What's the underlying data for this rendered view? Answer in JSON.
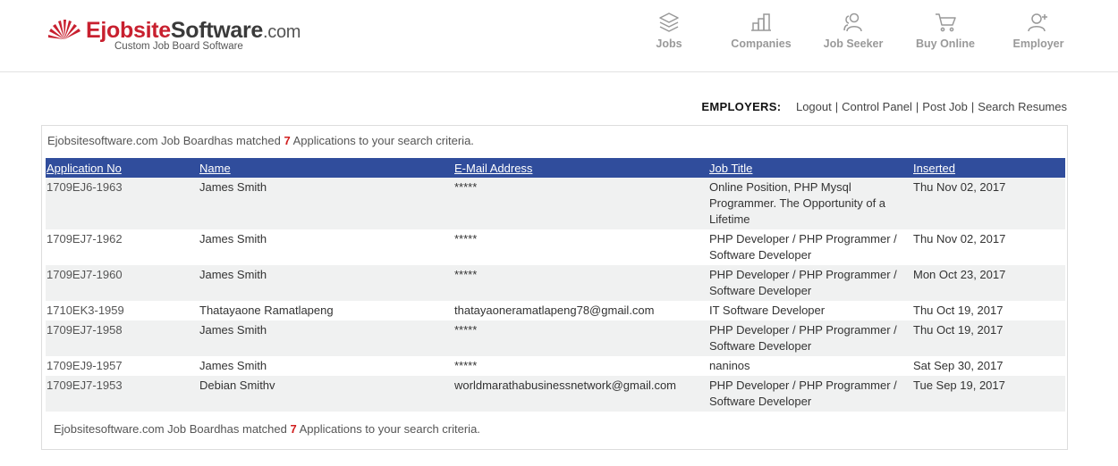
{
  "brand": {
    "part1": "Ejobsite",
    "part2": "Software",
    "part3": ".com",
    "tagline": "Custom Job Board Software",
    "accent": "#c8202f"
  },
  "nav": [
    {
      "label": "Jobs",
      "icon": "layers-icon"
    },
    {
      "label": "Companies",
      "icon": "building-icon"
    },
    {
      "label": "Job Seeker",
      "icon": "users-icon"
    },
    {
      "label": "Buy Online",
      "icon": "cart-icon"
    },
    {
      "label": "Employer",
      "icon": "user-plus-icon"
    }
  ],
  "employers": {
    "label": "EMPLOYERS:",
    "links": [
      "Logout",
      "Control Panel",
      "Post Job",
      "Search Resumes"
    ]
  },
  "summary": {
    "prefix": "Ejobsitesoftware.com Job Boardhas matched ",
    "count": "7",
    "suffix": " Applications to your search criteria."
  },
  "table": {
    "header_color": "#304d9c",
    "columns": [
      "Application No",
      "Name",
      "E-Mail Address",
      "Job Title",
      "Inserted"
    ],
    "rows": [
      [
        "1709EJ6-1963",
        "James Smith",
        "*****",
        "Online Position, PHP Mysql Programmer. The Opportunity of a Lifetime",
        "Thu Nov 02, 2017"
      ],
      [
        "1709EJ7-1962",
        "James Smith",
        "*****",
        "PHP Developer / PHP Programmer / Software Developer",
        "Thu Nov 02, 2017"
      ],
      [
        "1709EJ7-1960",
        "James Smith",
        "*****",
        "PHP Developer / PHP Programmer / Software Developer",
        "Mon Oct 23, 2017"
      ],
      [
        "1710EK3-1959",
        "Thatayaone Ramatlapeng",
        "thatayaoneramatlapeng78@gmail.com",
        "IT Software Developer",
        "Thu Oct 19, 2017"
      ],
      [
        "1709EJ7-1958",
        "James Smith",
        "*****",
        "PHP Developer / PHP Programmer / Software Developer",
        "Thu Oct 19, 2017"
      ],
      [
        "1709EJ9-1957",
        "James Smith",
        "*****",
        "naninos",
        "Sat Sep 30, 2017"
      ],
      [
        "1709EJ7-1953",
        "Debian Smithv",
        "worldmarathabusinessnetwork@gmail.com",
        "PHP Developer / PHP Programmer / Software Developer",
        "Tue Sep 19, 2017"
      ]
    ]
  }
}
